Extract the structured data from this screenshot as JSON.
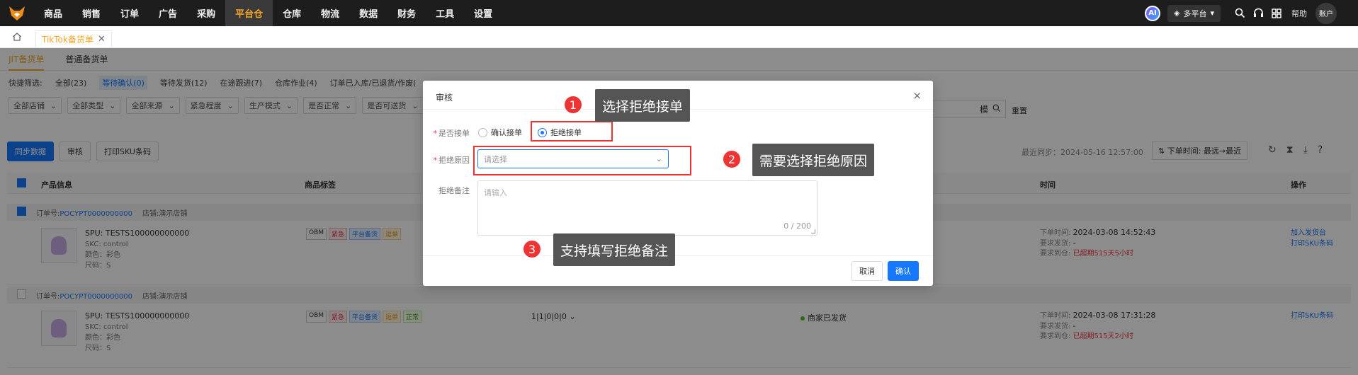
{
  "topnav": {
    "items": [
      "商品",
      "销售",
      "订单",
      "广告",
      "采购",
      "平台仓",
      "仓库",
      "物流",
      "数据",
      "财务",
      "工具",
      "设置"
    ],
    "active": "平台仓",
    "ai_label": "AI",
    "platform_label": "多平台",
    "help_label": "帮助",
    "account_label": "账户"
  },
  "tabbar": {
    "tab_label": "TikTok备货单",
    "close_glyph": "✕"
  },
  "subtabs": [
    "JIT备货单",
    "普通备货单"
  ],
  "quick_filter": {
    "label": "快捷筛选:",
    "items": [
      "全部(23)",
      "等待确认(0)",
      "等待发货(12)",
      "在途跟进(7)",
      "仓库作业(4)",
      "订单已入库/已退货/作废("
    ]
  },
  "filters": [
    "全部店铺",
    "全部类型",
    "全部来源",
    "紧急程度",
    "生产模式",
    "是否正常",
    "是否可送货"
  ],
  "search": {
    "mode_label": "模",
    "reset_label": "重置"
  },
  "toolbar": {
    "sync_label": "同步数据",
    "review_label": "审核",
    "print_label": "打印SKU条码",
    "sync_info": "最近同步：2024-05-16 12:57:00",
    "order_label": "下单时间: 最远→最近"
  },
  "table": {
    "headers": [
      "产品信息",
      "商品标签",
      "时间",
      "操作"
    ]
  },
  "orders": [
    {
      "order_no_label": "订单号:",
      "order_no": "POCYPT0000000000",
      "store_label": "店铺:",
      "store": "演示店铺",
      "spu": "SPU: TESTS100000000000",
      "skc": "SKC: control",
      "color": "颜色：彩色",
      "size": "尺码：S",
      "tags": [
        "OBM",
        "紧急",
        "平台备货",
        "逗单"
      ],
      "qty": "",
      "status": "",
      "order_time": "2024-03-08 14:52:43",
      "order_time_label": "下单时间:",
      "ship_req_label": "要求发货:",
      "ship_req": "-",
      "arrive_req_label": "要求到仓:",
      "arrive_req": "已超期515天5小时",
      "ops": [
        "加入发货台",
        "打印SKU条码"
      ]
    },
    {
      "order_no_label": "订单号:",
      "order_no": "POCYPT0000000000",
      "store_label": "店铺:",
      "store": "演示店铺",
      "spu": "SPU: TESTS100000000000",
      "skc": "SKC: control",
      "color": "颜色：彩色",
      "size": "尺码：S",
      "tags": [
        "OBM",
        "紧急",
        "平台备货",
        "逗单",
        "正常"
      ],
      "qty": "1|1|0|0|0",
      "status": "商家已发货",
      "order_time": "2024-03-08 17:31:28",
      "order_time_label": "下单时间:",
      "ship_req_label": "要求发货:",
      "ship_req": "-",
      "arrive_req_label": "要求到仓:",
      "arrive_req": "已超期515天2小时",
      "ops": [
        "打印SKU条码"
      ]
    }
  ],
  "modal": {
    "title": "审核",
    "close_glyph": "×",
    "accept_field_label": "是否接单",
    "accept_option": "确认接单",
    "reject_option": "拒绝接单",
    "selected": "拒绝接单",
    "reason_label": "拒绝原因",
    "reason_placeholder": "请选择",
    "remark_label": "拒绝备注",
    "remark_placeholder": "请输入",
    "remark_counter": "0 / 200",
    "cancel_label": "取消",
    "confirm_label": "确认"
  },
  "annotations": [
    {
      "num": "1",
      "text": "选择拒绝接单"
    },
    {
      "num": "2",
      "text": "需要选择拒绝原因"
    },
    {
      "num": "3",
      "text": "支持填写拒绝备注"
    }
  ],
  "colors": {
    "accent": "#f5a623",
    "primary": "#1677ff",
    "annotation_red": "#e33333",
    "callout_bg": "#555555"
  }
}
